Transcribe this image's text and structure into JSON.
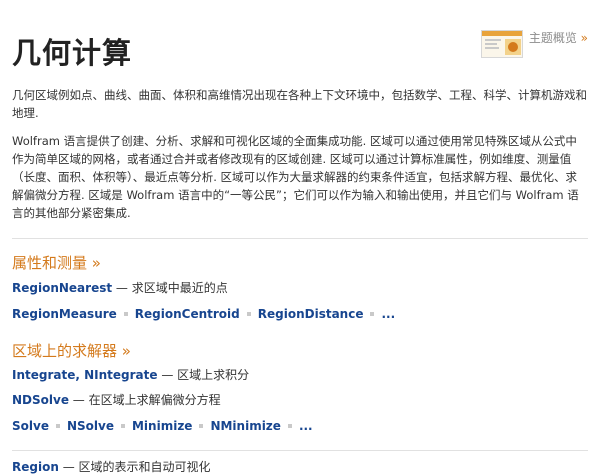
{
  "page_title": "几何计算",
  "overview": {
    "label": "主题概览",
    "chevron": "»"
  },
  "intro": [
    "几何区域例如点、曲线、曲面、体积和高维情况出现在各种上下文环境中，包括数学、工程、科学、计算机游戏和地理.",
    "Wolfram 语言提供了创建、分析、求解和可视化区域的全面集成功能. 区域可以通过使用常见特殊区域从公式中作为简单区域的网格，或者通过合并或者修改现有的区域创建. 区域可以通过计算标准属性，例如维度、测量值（长度、面积、体积等）、最近点等分析. 区域可以作为大量求解器的约束条件适宜，包括求解方程、最优化、求解偏微分方程. 区域是 Wolfram 语言中的“一等公民”；它们可以作为输入和输出使用，并且它们与 Wolfram 语言的其他部分紧密集成."
  ],
  "sections": [
    {
      "heading": "属性和测量 »",
      "lines": [
        {
          "fns": [
            "RegionNearest"
          ],
          "desc": " — 求区域中最近的点"
        },
        {
          "links": [
            "RegionMeasure",
            "RegionCentroid",
            "RegionDistance",
            "..."
          ]
        }
      ]
    },
    {
      "heading": "区域上的求解器 »",
      "lines": [
        {
          "fns": [
            "Integrate",
            "NIntegrate"
          ],
          "sep": ", ",
          "desc": " — 区域上求积分"
        },
        {
          "fns": [
            "NDSolve"
          ],
          "desc": " — 在区域上求解偏微分方程"
        },
        {
          "links": [
            "Solve",
            "NSolve",
            "Minimize",
            "NMinimize",
            "..."
          ]
        }
      ]
    }
  ],
  "cut_line": {
    "fn": "Region",
    "desc": " — 区域的表示和自动可视化"
  },
  "colors": {
    "accent": "#d47a1c",
    "link": "#17458f",
    "text": "#333333"
  }
}
